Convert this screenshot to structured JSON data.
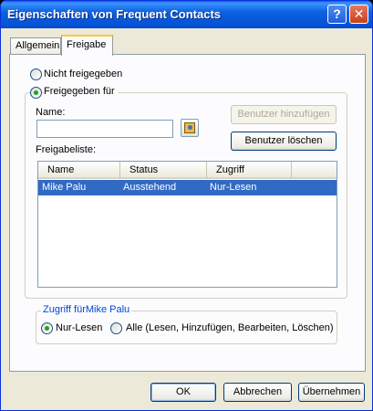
{
  "window": {
    "title": "Eigenschaften von Frequent Contacts",
    "help_glyph": "?",
    "close_glyph": "✕"
  },
  "tabs": [
    {
      "label": "Allgemein"
    },
    {
      "label": "Freigabe"
    }
  ],
  "sharing": {
    "not_shared": "Nicht freigegeben",
    "shared_for": "Freigegeben für",
    "name_label": "Name:",
    "name_value": "",
    "add_user": "Benutzer hinzufügen",
    "delete_user": "Benutzer löschen",
    "share_list_label": "Freigabeliste:",
    "columns": [
      "Name",
      "Status",
      "Zugriff"
    ],
    "rows": [
      {
        "name": "Mike Palu",
        "status": "Ausstehend",
        "access": "Nur-Lesen"
      }
    ]
  },
  "access": {
    "group_title": "Zugriff fürMike Palu",
    "read_only": "Nur-Lesen",
    "all": "Alle (Lesen, Hinzufügen, Bearbeiten, Löschen)"
  },
  "footer": {
    "ok": "OK",
    "cancel": "Abbrechen",
    "apply": "Übernehmen"
  }
}
